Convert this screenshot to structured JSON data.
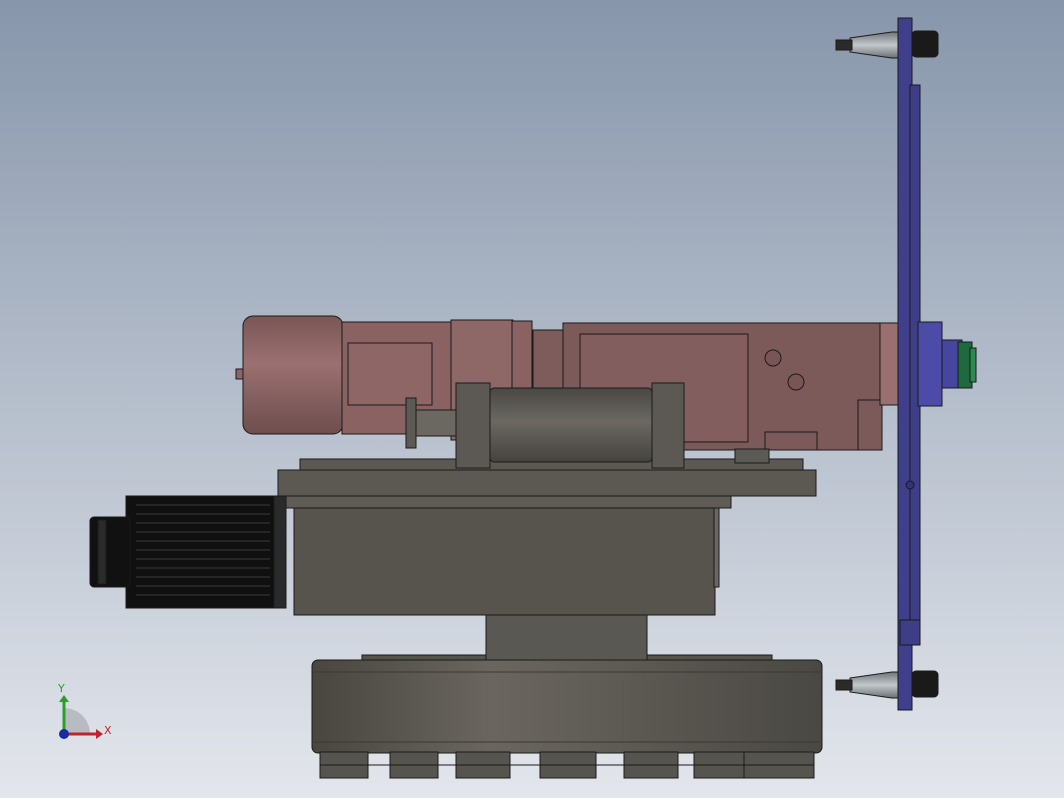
{
  "triad": {
    "x_label": "X",
    "y_label": "Y",
    "x_color": "#c8202a",
    "y_color": "#2aa02a",
    "origin_color": "#1a2aa0"
  },
  "colors": {
    "background_top": "#8796ab",
    "background_bottom": "#e3e6ec",
    "gearbox_body": "#8a6262",
    "spindle_housing": "#7d5a5a",
    "base_metal": "#5a5752",
    "servo_motor": "#141414",
    "tool_plate": "#3e3f8a",
    "tool_holder": "#9aa0a6",
    "collet": "#1e6a3e"
  }
}
